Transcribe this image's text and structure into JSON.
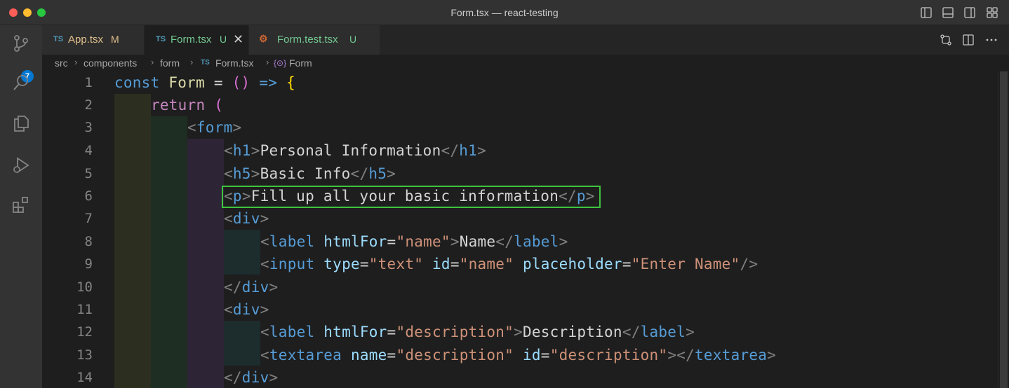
{
  "window": {
    "title": "Form.tsx — react-testing"
  },
  "activity_bar": {
    "scm_badge": "7"
  },
  "tabs": [
    {
      "icon": "TS",
      "name": "App.tsx",
      "status": "M",
      "name_color": "#e2c08d",
      "status_color": "#e2c08d"
    },
    {
      "icon": "TS",
      "name": "Form.tsx",
      "status": "U",
      "name_color": "#73c991",
      "status_color": "#73c991",
      "close": "✕"
    },
    {
      "icon": "⚙",
      "name": "Form.test.tsx",
      "status": "U",
      "name_color": "#73c991",
      "status_color": "#73c991"
    }
  ],
  "breadcrumb": {
    "items": [
      "src",
      "components",
      "form",
      "Form.tsx",
      "Form"
    ],
    "file_icon": "TS",
    "symbol_icon": "{⊙}"
  },
  "code": {
    "line_numbers": [
      "1",
      "2",
      "3",
      "4",
      "5",
      "6",
      "7",
      "8",
      "9",
      "10",
      "11",
      "12",
      "13",
      "14"
    ],
    "l1": {
      "kw": "const",
      "name": "Form",
      "eq": " = ",
      "parens": "()",
      "arrow": " => ",
      "brace": "{"
    },
    "l2": {
      "kw": "return",
      "paren": " ("
    },
    "l3": {
      "tag": "form"
    },
    "l4": {
      "tag": "h1",
      "text": "Personal Information"
    },
    "l5": {
      "tag": "h5",
      "text": "Basic Info"
    },
    "l6": {
      "tag": "p",
      "text": "Fill up all your basic information"
    },
    "l7": {
      "tag": "div"
    },
    "l8": {
      "tag": "label",
      "attr": "htmlFor",
      "val": "\"name\"",
      "text": "Name"
    },
    "l9": {
      "tag": "input",
      "a1": "type",
      "v1": "\"text\"",
      "a2": "id",
      "v2": "\"name\"",
      "a3": "placeholder",
      "v3": "\"Enter Name\""
    },
    "l10": {
      "tag": "div"
    },
    "l11": {
      "tag": "div"
    },
    "l12": {
      "tag": "label",
      "attr": "htmlFor",
      "val": "\"description\"",
      "text": "Description"
    },
    "l13": {
      "tag": "textarea",
      "a1": "name",
      "v1": "\"description\"",
      "a2": "id",
      "v2": "\"description\""
    },
    "l14": {
      "tag": "div"
    }
  },
  "colors": {
    "highlight_box": "#3ec43e",
    "accent": "#0078d4"
  }
}
